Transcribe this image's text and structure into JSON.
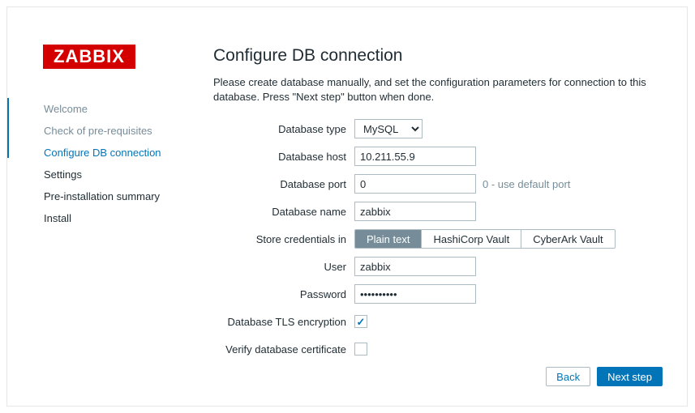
{
  "logo_text": "ZABBIX",
  "sidebar": {
    "items": [
      {
        "label": "Welcome",
        "state": "done"
      },
      {
        "label": "Check of pre-requisites",
        "state": "done"
      },
      {
        "label": "Configure DB connection",
        "state": "active"
      },
      {
        "label": "Settings",
        "state": ""
      },
      {
        "label": "Pre-installation summary",
        "state": ""
      },
      {
        "label": "Install",
        "state": ""
      }
    ]
  },
  "page": {
    "title": "Configure DB connection",
    "lead": "Please create database manually, and set the configuration parameters for connection to this database. Press \"Next step\" button when done."
  },
  "form": {
    "db_type": {
      "label": "Database type",
      "value": "MySQL"
    },
    "db_host": {
      "label": "Database host",
      "value": "10.211.55.9"
    },
    "db_port": {
      "label": "Database port",
      "value": "0",
      "hint": "0 - use default port"
    },
    "db_name": {
      "label": "Database name",
      "value": "zabbix"
    },
    "store_creds": {
      "label": "Store credentials in",
      "options": [
        "Plain text",
        "HashiCorp Vault",
        "CyberArk Vault"
      ],
      "selected": "Plain text"
    },
    "user": {
      "label": "User",
      "value": "zabbix"
    },
    "password": {
      "label": "Password",
      "value": "••••••••••"
    },
    "tls": {
      "label": "Database TLS encryption",
      "checked": true
    },
    "verify_cert": {
      "label": "Verify database certificate",
      "checked": false
    }
  },
  "buttons": {
    "back": "Back",
    "next": "Next step"
  }
}
